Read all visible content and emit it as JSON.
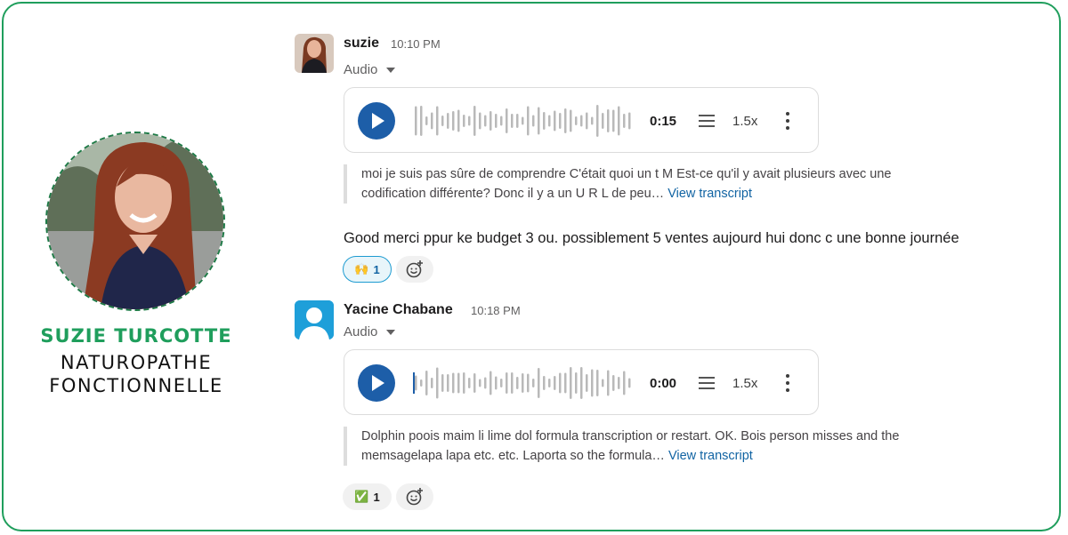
{
  "profile": {
    "name": "SUZIE TURCOTTE",
    "role_line1": "NATUROPATHE",
    "role_line2": "FONCTIONNELLE",
    "brand_color": "#1f9e5c"
  },
  "messages": [
    {
      "author": "suzie",
      "time": "10:10 PM",
      "attachment_label": "Audio",
      "audio": {
        "duration": "0:15",
        "speed": "1.5x",
        "progress": 0
      },
      "transcript": "moi je suis pas sûre de comprendre C'était quoi un t M Est-ce qu'il y avait plusieurs avec une codification différente? Donc il y a un U R L de peu…",
      "transcript_link": "View transcript",
      "text": "Good merci ppur ke budget 3 ou. possiblement  5 ventes aujourd hui donc c  une bonne journée",
      "reactions": [
        {
          "emoji": "🙌",
          "count": "1",
          "active": true
        }
      ]
    },
    {
      "author": "Yacine Chabane",
      "time": "10:18 PM",
      "attachment_label": "Audio",
      "audio": {
        "duration": "0:00",
        "speed": "1.5x",
        "progress": 0
      },
      "transcript": "Dolphin poois maim li lime dol formula transcription or restart. OK. Bois person misses and the memsagelapa lapa etc. etc. Laporta so the formula…",
      "transcript_link": "View transcript",
      "reactions": [
        {
          "emoji": "✅",
          "count": "1",
          "active": false
        }
      ]
    }
  ]
}
